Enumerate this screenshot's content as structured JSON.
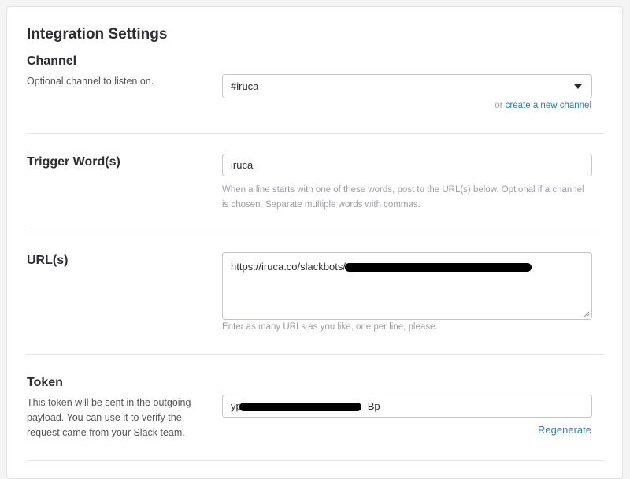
{
  "page": {
    "title": "Integration Settings"
  },
  "channel": {
    "title": "Channel",
    "description": "Optional channel to listen on.",
    "selected": "#iruca",
    "alt_prefix": "or",
    "create_link": "create a new channel"
  },
  "trigger": {
    "title": "Trigger Word(s)",
    "value": "iruca",
    "hint": "When a line starts with one of these words, post to the URL(s) below. Optional if a channel is chosen. Separate multiple words with commas."
  },
  "urls": {
    "title": "URL(s)",
    "value": "https://iruca.co/slackbots/",
    "hint": "Enter as many URLs as you like, one per line, please."
  },
  "token": {
    "title": "Token",
    "description": "This token will be sent in the outgoing payload. You can use it to verify the request came from your Slack team.",
    "value_prefix": "yp",
    "value_suffix": "Bp",
    "regenerate": "Regenerate"
  },
  "colors": {
    "link": "#2a80b9",
    "text": "#2c2d30",
    "muted": "#9e9ea6"
  },
  "icons": {
    "select": "chevron-down-icon",
    "resize": "resize-handle-icon"
  }
}
